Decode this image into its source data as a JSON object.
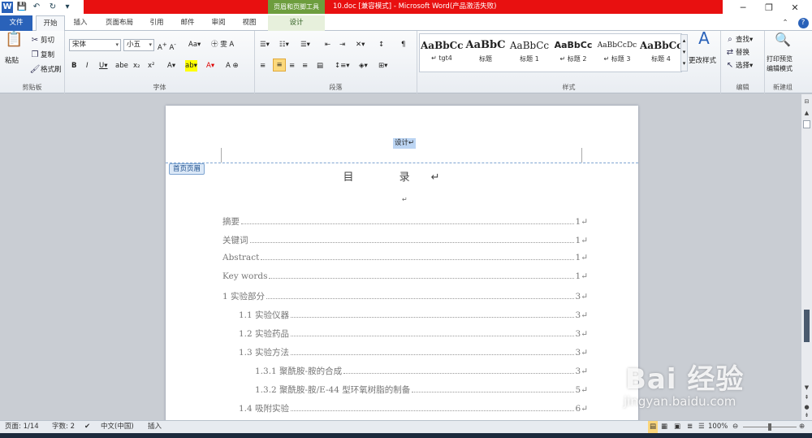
{
  "window": {
    "title": "10.doc [兼容模式] - Microsoft Word(产品激活失败)",
    "context_tool": "页眉和页脚工具",
    "controls": {
      "minimize": "─",
      "restore": "❐",
      "close": "✕"
    }
  },
  "qat": {
    "app_icon": "W",
    "save": "💾",
    "undo": "↶",
    "redo": "↻",
    "extra": "▾"
  },
  "tabs": [
    {
      "label": "文件"
    },
    {
      "label": "开始"
    },
    {
      "label": "插入"
    },
    {
      "label": "页面布局"
    },
    {
      "label": "引用"
    },
    {
      "label": "邮件"
    },
    {
      "label": "审阅"
    },
    {
      "label": "视图"
    },
    {
      "label": "设计"
    }
  ],
  "ribbon": {
    "clipboard": {
      "label": "剪贴板",
      "paste": "粘贴",
      "cut": "剪切",
      "copy": "复制",
      "format_painter": "格式刷"
    },
    "font": {
      "label": "字体",
      "font_name": "宋体",
      "font_size": "小五"
    },
    "paragraph": {
      "label": "段落"
    },
    "styles": {
      "label": "样式",
      "items": [
        {
          "sample": "AaBbCcDc",
          "name": "↵ tgt4"
        },
        {
          "sample": "AaBbC",
          "name": "标题"
        },
        {
          "sample": "AaBbCc",
          "name": "标题 1"
        },
        {
          "sample": "AaBbCc",
          "name": "↵ 标题 2"
        },
        {
          "sample": "AaBbCcDc",
          "name": "↵ 标题 3"
        },
        {
          "sample": "AaBbCc",
          "name": "标题 4"
        }
      ],
      "change_styles": "更改样式"
    },
    "editing": {
      "label": "编辑",
      "find": "查找",
      "replace": "替换",
      "select": "选择"
    },
    "new_group": {
      "label": "新建组",
      "print_preview": "打印预览",
      "edit_mode": "编辑模式"
    }
  },
  "document": {
    "header_text": "设计↵",
    "header_tag": "首页页眉",
    "toc_title": "目 录↵",
    "empty_para": "↵",
    "toc": [
      {
        "label": "摘要",
        "page": "1↵"
      },
      {
        "label": "关键词",
        "page": "1↵"
      },
      {
        "label": "Abstract",
        "page": "1↵"
      },
      {
        "label": "Key words",
        "page": "1↵"
      },
      {
        "label": "1  实验部分",
        "page": "3↵"
      },
      {
        "label": "1.1  实验仪器",
        "page": "3↵"
      },
      {
        "label": "1.2  实验药品",
        "page": "3↵"
      },
      {
        "label": "1.3  实验方法",
        "page": "3↵"
      },
      {
        "label": "1.3.1  聚酰胺-胺的合成",
        "page": "3↵"
      },
      {
        "label": "1.3.2  聚酰胺-胺/E-44 型环氧树脂的制备",
        "page": "5↵"
      },
      {
        "label": "1.4  吸附实验",
        "page": "6↵"
      }
    ]
  },
  "status": {
    "page": "页面: 1/14",
    "words": "字数: 2",
    "language": "中文(中国)",
    "mode": "插入",
    "zoom": "100%"
  },
  "watermark": {
    "brand": "Bai 经验",
    "url": "jingyan.baidu.com"
  },
  "colors": {
    "title_red": "#e81010",
    "file_tab": "#2a62b9",
    "context_green": "#6d9d3d"
  }
}
